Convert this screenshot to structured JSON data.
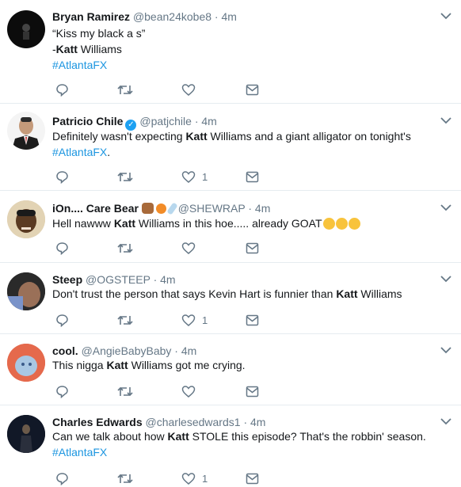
{
  "tweets": [
    {
      "name": "Bryan Ramirez",
      "handle": "@bean24kobe8",
      "dot": "·",
      "time": "4m",
      "line1": "“Kiss my black a  s”",
      "line2_prefix": "-",
      "line2_bold": "Katt",
      "line2_rest": " Williams",
      "hashtag": "#AtlantaFX",
      "like_count": ""
    },
    {
      "name": "Patricio Chile",
      "handle": "@patjchile",
      "dot": "·",
      "time": "4m",
      "text_pre": "Definitely wasn't expecting ",
      "text_bold": "Katt",
      "text_post": " Williams and a giant alligator on tonight's",
      "hashtag": "#AtlantaFX",
      "hashtag_suffix": ".",
      "like_count": "1"
    },
    {
      "name": "iOn.... Care Bear",
      "handle": "@SHEWRAP",
      "dot": "·",
      "time": "4m",
      "text_pre": "Hell nawww ",
      "text_bold": "Katt",
      "text_post": " Williams in this hoe..... already GOAT",
      "like_count": ""
    },
    {
      "name": "Steep",
      "handle": "@OGSTEEP",
      "dot": "·",
      "time": "4m",
      "text_pre": "Don't trust the person that says Kevin Hart is funnier than ",
      "text_bold": "Katt",
      "text_post": " Williams",
      "like_count": "1"
    },
    {
      "name": "cool.",
      "handle": "@AngieBabyBaby",
      "dot": "·",
      "time": "4m",
      "text_pre": "This nigga ",
      "text_bold": "Katt",
      "text_post": " Williams got me crying.",
      "like_count": ""
    },
    {
      "name": "Charles Edwards",
      "handle": "@charlesedwards1",
      "dot": "·",
      "time": "4m",
      "text_pre": "Can we talk about how ",
      "text_bold": "Katt",
      "text_post": " STOLE this episode? That's the robbin' season.",
      "hashtag": "#AtlantaFX",
      "like_count": "1"
    }
  ],
  "colors": {
    "link": "#1b95e0",
    "muted": "#657786",
    "verified": "#1da1f2"
  }
}
